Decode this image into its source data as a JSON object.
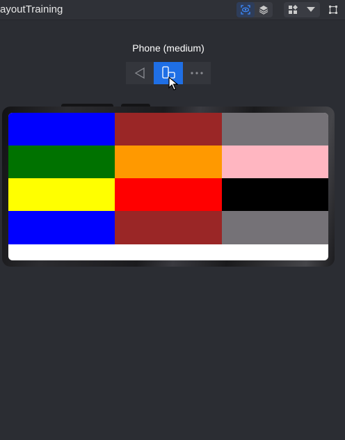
{
  "app": {
    "title": "ayoutTraining"
  },
  "toolbar": {
    "icons": [
      "eye-scan-icon",
      "layers-icon",
      "components-icon",
      "dropdown-triangle-icon",
      "frame-select-icon"
    ]
  },
  "device": {
    "label": "Phone (medium)",
    "controls": [
      "back-triangle-icon",
      "rotate-device-icon",
      "more-dots-icon"
    ],
    "active_control": "rotate-device-icon"
  },
  "grid": {
    "rows": [
      [
        "#0000ff",
        "#9a2626",
        "#757277"
      ],
      [
        "#007200",
        "#ff9900",
        "#ffb6c1"
      ],
      [
        "#ffff00",
        "#ff0000",
        "#000000"
      ],
      [
        "#0000ff",
        "#9a2626",
        "#757277"
      ]
    ],
    "background": "#ffffff"
  },
  "colors": {
    "accent": "#1f6fe5",
    "panel": "#2b2d33"
  }
}
